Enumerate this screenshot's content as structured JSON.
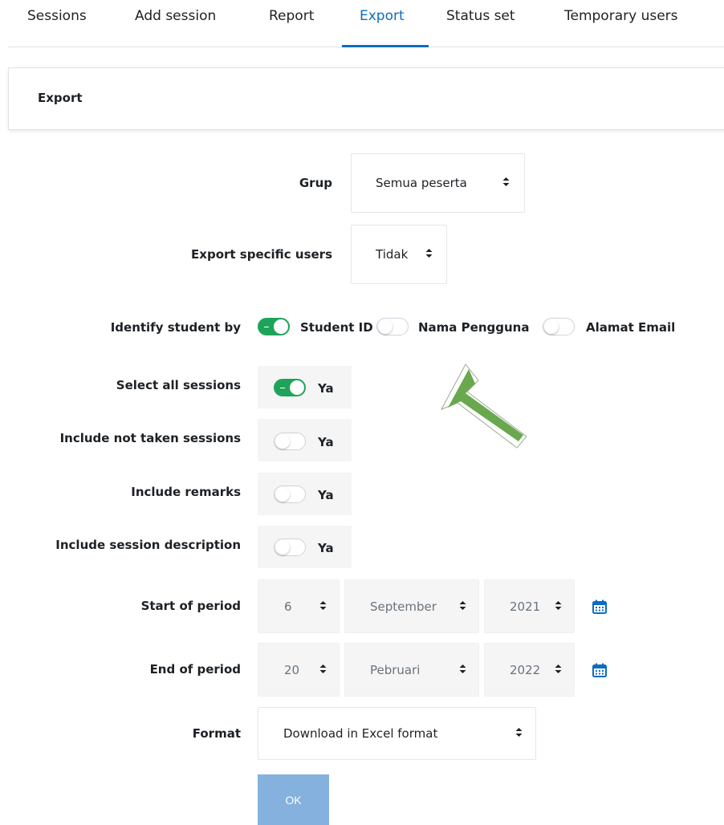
{
  "tabs": [
    {
      "label": "Sessions"
    },
    {
      "label": "Add session"
    },
    {
      "label": "Report"
    },
    {
      "label": "Export"
    },
    {
      "label": "Status set"
    },
    {
      "label": "Temporary users"
    }
  ],
  "active_tab": "Export",
  "card": {
    "title": "Export"
  },
  "form": {
    "group": {
      "label": "Grup",
      "value": "Semua peserta"
    },
    "specific_users": {
      "label": "Export specific users",
      "value": "Tidak"
    },
    "identify": {
      "label": "Identify student by",
      "options": [
        {
          "label": "Student ID",
          "checked": true
        },
        {
          "label": "Nama Pengguna",
          "checked": false
        },
        {
          "label": "Alamat Email",
          "checked": false
        }
      ]
    },
    "select_all_sessions": {
      "label": "Select all sessions",
      "value_label": "Ya",
      "checked": true
    },
    "include_not_taken": {
      "label": "Include not taken sessions",
      "value_label": "Ya",
      "checked": false
    },
    "include_remarks": {
      "label": "Include remarks",
      "value_label": "Ya",
      "checked": false
    },
    "include_description": {
      "label": "Include session description",
      "value_label": "Ya",
      "checked": false
    },
    "start_period": {
      "label": "Start of period",
      "day": "6",
      "month": "September",
      "year": "2021"
    },
    "end_period": {
      "label": "End of period",
      "day": "20",
      "month": "Pebruari",
      "year": "2022"
    },
    "format": {
      "label": "Format",
      "value": "Download in Excel format"
    },
    "submit_label": "OK"
  },
  "colors": {
    "accent": "#0f6cbf",
    "toggle_on": "#1ea45a",
    "ok_button": "#84b1dd",
    "annotation_arrow": "#6aa84f"
  },
  "icons": {
    "calendar": "calendar-icon",
    "select_arrow": "updown-arrow-icon",
    "annotation": "annotation-arrow-icon"
  }
}
